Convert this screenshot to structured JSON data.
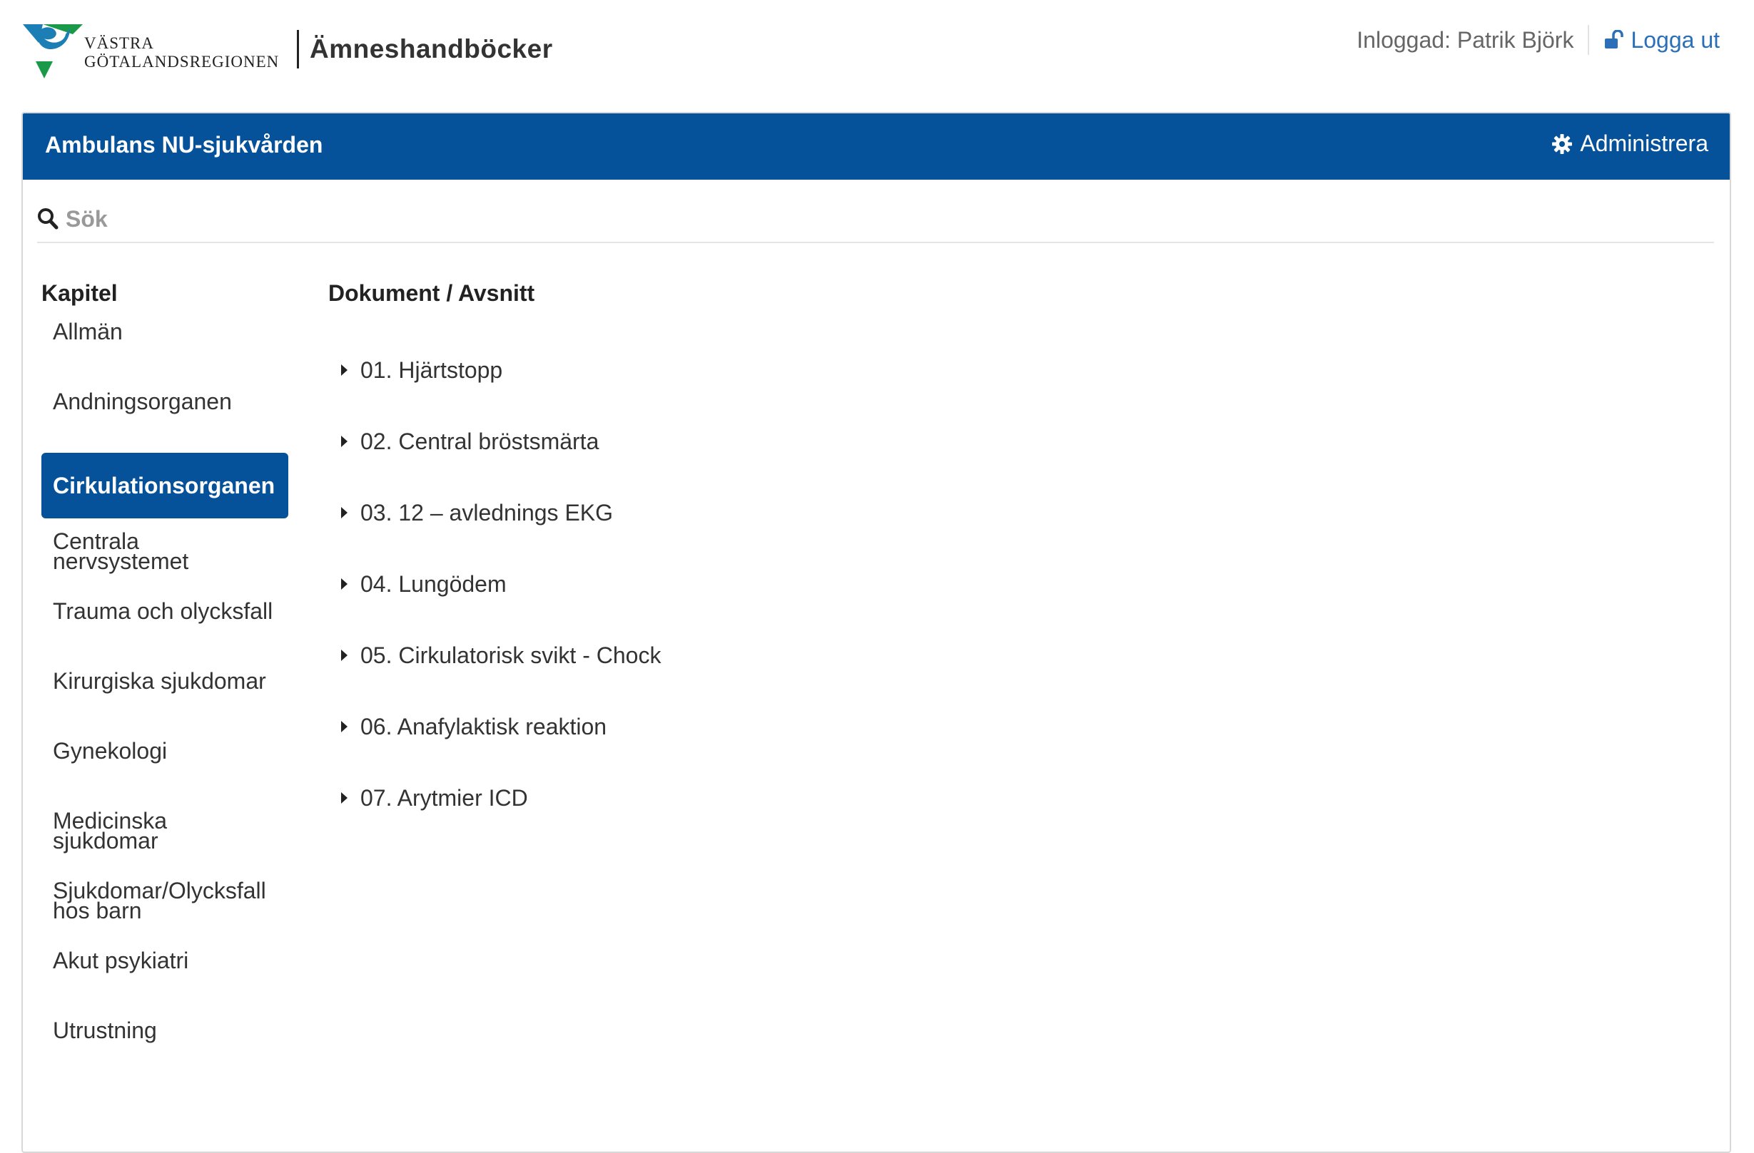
{
  "header": {
    "logo_line1": "VÄSTRA",
    "logo_line2": "GÖTALANDSREGIONEN",
    "app_title": "Ämneshandböcker",
    "user_label": "Inloggad: Patrik Björk",
    "logout_label": "Logga ut"
  },
  "panel": {
    "title": "Ambulans NU-sjukvården",
    "admin_label": "Administrera"
  },
  "search": {
    "placeholder": "Sök"
  },
  "chapters": {
    "heading": "Kapitel",
    "items": [
      {
        "label": "Allmän"
      },
      {
        "label": "Andningsorganen"
      },
      {
        "label": "Cirkulationsorganen",
        "active": true
      },
      {
        "label": "Centrala nervsystemet"
      },
      {
        "label": "Trauma och olycksfall"
      },
      {
        "label": "Kirurgiska sjukdomar"
      },
      {
        "label": "Gynekologi"
      },
      {
        "label": "Medicinska sjukdomar"
      },
      {
        "label": "Sjukdomar/Olycksfall hos barn"
      },
      {
        "label": "Akut psykiatri"
      },
      {
        "label": "Utrustning"
      }
    ]
  },
  "documents": {
    "heading": "Dokument / Avsnitt",
    "items": [
      {
        "label": "01. Hjärtstopp"
      },
      {
        "label": "02. Central bröstsmärta"
      },
      {
        "label": "03. 12 – avlednings EKG"
      },
      {
        "label": "04. Lungödem"
      },
      {
        "label": "05. Cirkulatorisk svikt - Chock"
      },
      {
        "label": "06. Anafylaktisk reaktion"
      },
      {
        "label": "07. Arytmier ICD"
      }
    ]
  },
  "colors": {
    "brand_blue": "#06529a",
    "link_blue": "#2a6fb8",
    "logo_teal": "#1b7fb5",
    "logo_green": "#1a9a48"
  }
}
